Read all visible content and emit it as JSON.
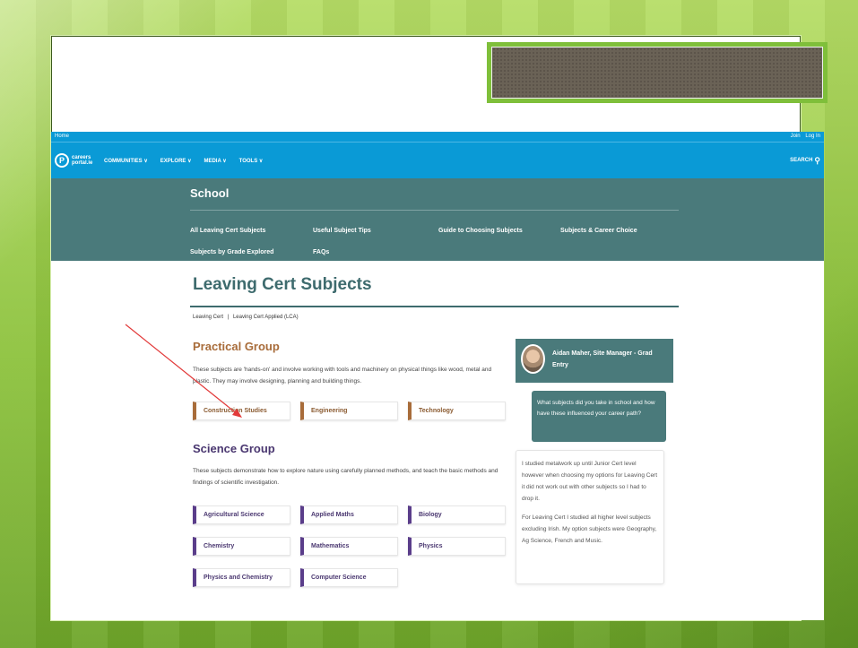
{
  "site": {
    "topbar": {
      "left": "Home",
      "join": "Join",
      "login": "Log In"
    },
    "brand": {
      "logo_glyph": "P",
      "logo_text": "careers portal.ie"
    },
    "nav": [
      {
        "label": "COMMUNITIES ∨"
      },
      {
        "label": "EXPLORE ∨"
      },
      {
        "label": "MEDIA ∨"
      },
      {
        "label": "TOOLS ∨"
      }
    ],
    "search": {
      "label": "SEARCH",
      "icon": "search-icon"
    },
    "section": {
      "title": "School",
      "links": [
        "All Leaving Cert Subjects",
        "Useful Subject Tips",
        "Guide to Choosing Subjects",
        "Subjects & Career Choice",
        "Subjects by Grade Explored",
        "FAQs"
      ]
    },
    "page": {
      "title": "Leaving Cert Subjects",
      "breadcrumb": [
        "Leaving Cert",
        "Leaving Cert Applied (LCA)"
      ],
      "breadcrumb_sep": "|"
    },
    "practical": {
      "title": "Practical Group",
      "description": "These subjects are 'hands-on' and involve working with tools and machinery on physical things like wood, metal and plastic. They may involve designing, planning and building things.",
      "subjects": [
        "Construction Studies",
        "Engineering",
        "Technology"
      ]
    },
    "science": {
      "title": "Science Group",
      "description": "These subjects demonstrate how to explore nature using carefully planned methods, and teach the basic methods and findings of scientific investigation.",
      "subjects": [
        "Agricultural Science",
        "Applied Maths",
        "Biology",
        "Chemistry",
        "Mathematics",
        "Physics",
        "Physics and Chemistry",
        "Computer Science"
      ]
    },
    "staff_card": {
      "name": "Aidan Maher, Site Manager - Grad Entry",
      "question": "What subjects did you take in school and how have these influenced your career path?",
      "answer_1": "I studied metalwork up until Junior Cert level however when choosing my options for Leaving Cert it did not work out with other subjects so I had to drop it.",
      "answer_2": "For Leaving Cert I studied all higher level subjects excluding Irish. My option subjects were Geography, Ag Science, French and Music."
    }
  },
  "colors": {
    "accent_blue": "#0a9ad6",
    "teal": "#4a7a7b",
    "practical": "#a86c3a",
    "science": "#5a3d8a",
    "slide_green": "#8fc33a",
    "annotation": "#e23a3a"
  }
}
